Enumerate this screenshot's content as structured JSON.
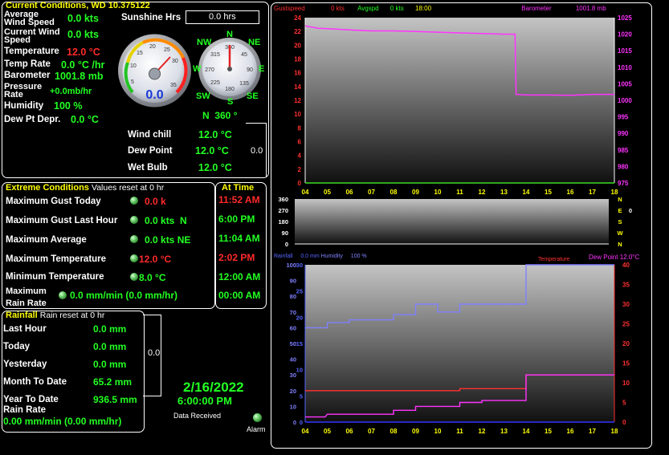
{
  "current": {
    "title": "Current Conditions, WD 10.375122",
    "avg_wind_label": "Average Wind Speed",
    "avg_wind_value": "0.0 kts",
    "cur_wind_label": "Current Wind Speed",
    "cur_wind_value": "0.0 kts",
    "temp_label": "Temperature",
    "temp_value": "12.0 °C",
    "temp_rate_label": "Temp Rate",
    "temp_rate_value": "0.0 °C /hr",
    "baro_label": "Barometer",
    "baro_value": "1001.8 mb",
    "press_rate_label": "Pressure Rate",
    "press_rate_value": "+0.0mb/hr",
    "humidity_label": "Humidity",
    "humidity_value": "100 %",
    "dewpt_dep_label": "Dew Pt Depr.",
    "dewpt_dep_value": "0.0 °C",
    "sunshine_label": "Sunshine Hrs",
    "sunshine_value": "0.0  hrs",
    "wind_gauge_value": "0.0",
    "compass_n": "N",
    "compass_ne": "NE",
    "compass_e": "E",
    "compass_se": "SE",
    "compass_s": "S",
    "compass_sw": "SW",
    "compass_w": "W",
    "compass_nw": "NW",
    "compass_readout": "N  360 °",
    "compass_deg_360": "360",
    "compass_deg_45": "45",
    "compass_deg_90": "90",
    "compass_deg_135": "135",
    "compass_deg_180": "180",
    "compass_deg_225": "225",
    "compass_deg_270": "270",
    "compass_deg_315": "315",
    "gauge_ticks": [
      "5",
      "10",
      "15",
      "20",
      "25",
      "30",
      "35"
    ],
    "wind_chill_label": "Wind chill",
    "wind_chill_value": "12.0 °C",
    "dew_point_label": "Dew Point",
    "dew_point_value": "12.0 °C",
    "wet_bulb_label": "Wet Bulb",
    "wet_bulb_value": "12.0 °C",
    "side_value": "0.0"
  },
  "extreme": {
    "title": "Extreme Conditions",
    "subtitle": "Values reset at 0 hr",
    "max_gust_today_label": "Maximum Gust Today",
    "max_gust_today_value": "0.0 k",
    "max_gust_hour_label": "Maximum Gust Last Hour",
    "max_gust_hour_value": "0.0 kts  N",
    "max_avg_label": "Maximum Average",
    "max_avg_value": "0.0 kts NE",
    "max_temp_label": "Maximum Temperature",
    "max_temp_value": "12.0 °C",
    "min_temp_label": "Minimum Temperature",
    "min_temp_value": "8.0 °C",
    "max_rain_label": "Maximum Rain Rate",
    "max_rain_value": "0.0 mm/min (0.0 mm/hr)",
    "at_time_title": "At Time",
    "times": [
      "11:52 AM",
      "6:00 PM",
      "11:04 AM",
      "2:02 PM",
      "12:00 AM",
      "00:00 AM"
    ]
  },
  "rainfall": {
    "title": "Rainfall",
    "subtitle": "Rain reset at 0 hr",
    "last_hour_label": "Last Hour",
    "last_hour_value": "0.0 mm",
    "today_label": "Today",
    "today_value": "0.0 mm",
    "yesterday_label": "Yesterday",
    "yesterday_value": "0.0 mm",
    "month_label": "Month To Date",
    "month_value": "65.2 mm",
    "year_label": "Year To Date",
    "year_value": "936.5 mm",
    "rate_label": "Rain Rate",
    "rate_value": "0.00 mm/min (0.00 mm/hr)",
    "side_value": "0.0"
  },
  "status": {
    "date": "2/16/2022",
    "time": "6:00:00 PM",
    "data_received_label": "Data Received",
    "alarm_label": "Alarm"
  },
  "colors": {
    "accent_yellow": "#ffff00",
    "value_green": "#22ff22",
    "value_red": "#ff2a2a",
    "barometer_magenta": "#ff33ff",
    "humidity_blue": "#8080ff",
    "rain_blue": "#3333ff"
  },
  "chart_data": [
    {
      "type": "line",
      "legend": {
        "gust_label": "Gustspeed",
        "gust_value": "0 kts",
        "avg_label": "Avgspd",
        "avg_value": "0 kts",
        "time_label": "18:00",
        "baro_label": "Barometer",
        "baro_value": "1001.8 mb"
      },
      "x_ticks": [
        "04",
        "05",
        "06",
        "07",
        "08",
        "09",
        "10",
        "11",
        "12",
        "13",
        "14",
        "15",
        "16",
        "17",
        "18"
      ],
      "x_range": [
        4,
        18
      ],
      "y_left_range": [
        0,
        24
      ],
      "y_left_ticks": [
        0,
        2,
        4,
        6,
        8,
        10,
        12,
        14,
        16,
        18,
        20,
        22,
        24
      ],
      "y_right_range": [
        975,
        1025
      ],
      "y_right_ticks": [
        975,
        980,
        985,
        990,
        995,
        1000,
        1005,
        1010,
        1015,
        1020,
        1025
      ],
      "series": [
        {
          "name": "Gustspeed",
          "axis": "left",
          "x": [
            4,
            18
          ],
          "values": [
            0,
            0
          ]
        },
        {
          "name": "Avgspd",
          "axis": "left",
          "x": [
            4,
            18
          ],
          "values": [
            0,
            0
          ]
        },
        {
          "name": "Barometer",
          "axis": "right",
          "x": [
            4,
            4.6,
            5.2,
            6,
            7,
            8,
            9,
            10,
            11,
            12,
            13,
            13.5,
            13.55,
            14,
            15,
            16,
            17,
            18
          ],
          "values": [
            1022.5,
            1021.8,
            1021.6,
            1021.3,
            1021.0,
            1021.0,
            1020.8,
            1020.6,
            1020.4,
            1020.2,
            1020.0,
            1020.0,
            1001.8,
            1001.6,
            1001.6,
            1001.5,
            1001.8,
            1001.8
          ]
        }
      ]
    },
    {
      "type": "line",
      "x_range": [
        4,
        18
      ],
      "y_left_ticks": [
        0,
        90,
        180,
        270,
        360
      ],
      "y_left_range": [
        0,
        360
      ],
      "y_right_labels": [
        "N",
        "W",
        "S",
        "E",
        "N"
      ],
      "y_right_extra": "0",
      "series": [
        {
          "name": "Wind direction",
          "x": [],
          "values": []
        }
      ]
    },
    {
      "type": "line",
      "legend": {
        "rain_label": "Rainfall",
        "rain_value": "0.0 mm",
        "humidity_label": "Humidity",
        "humidity_value": "100 %",
        "temp_label": "Temperature",
        "dew_label": "Dew Point",
        "dew_value": "12.0°C"
      },
      "x_ticks": [
        "04",
        "05",
        "06",
        "07",
        "08",
        "09",
        "10",
        "11",
        "12",
        "13",
        "14",
        "15",
        "16",
        "17",
        "18"
      ],
      "x_range": [
        4,
        18
      ],
      "y_left_range": [
        0,
        100
      ],
      "y_left_ticks": [
        0,
        10,
        20,
        30,
        40,
        50,
        60,
        70,
        80,
        90,
        100
      ],
      "y_mid_range": [
        0,
        30
      ],
      "y_mid_ticks": [
        0,
        5,
        10,
        15,
        20,
        25,
        30
      ],
      "y_right_range": [
        0,
        40
      ],
      "y_right_ticks": [
        0,
        5,
        10,
        15,
        20,
        25,
        30,
        35,
        40
      ],
      "series": [
        {
          "name": "Humidity",
          "axis": "mid",
          "x": [
            4,
            4,
            5,
            5,
            6,
            6,
            8,
            8,
            9,
            9,
            10,
            10,
            11,
            11,
            12,
            12,
            13,
            13,
            14,
            14,
            18
          ],
          "values": [
            18,
            18,
            18,
            19,
            19,
            19.5,
            19.5,
            20.5,
            20.5,
            22.5,
            22.5,
            21,
            21,
            22.5,
            22.5,
            22.5,
            22.5,
            22.5,
            22.5,
            30,
            30
          ]
        },
        {
          "name": "Temperature",
          "axis": "right",
          "x": [
            4,
            11,
            11,
            14,
            14,
            18
          ],
          "values": [
            8,
            8,
            8.5,
            8.5,
            12,
            12
          ]
        },
        {
          "name": "Dew Point",
          "axis": "right",
          "x": [
            4,
            4.9,
            5,
            7,
            8,
            8,
            9,
            9,
            10,
            11,
            11,
            12,
            12,
            13,
            14,
            14,
            18
          ],
          "values": [
            1.3,
            1.3,
            2,
            2,
            2,
            3,
            3,
            4,
            4,
            4,
            5,
            5,
            5.5,
            5.5,
            5.5,
            12,
            12
          ]
        },
        {
          "name": "Rainfall",
          "axis": "left",
          "x": [
            4,
            18
          ],
          "values": [
            0,
            0
          ]
        }
      ]
    }
  ]
}
